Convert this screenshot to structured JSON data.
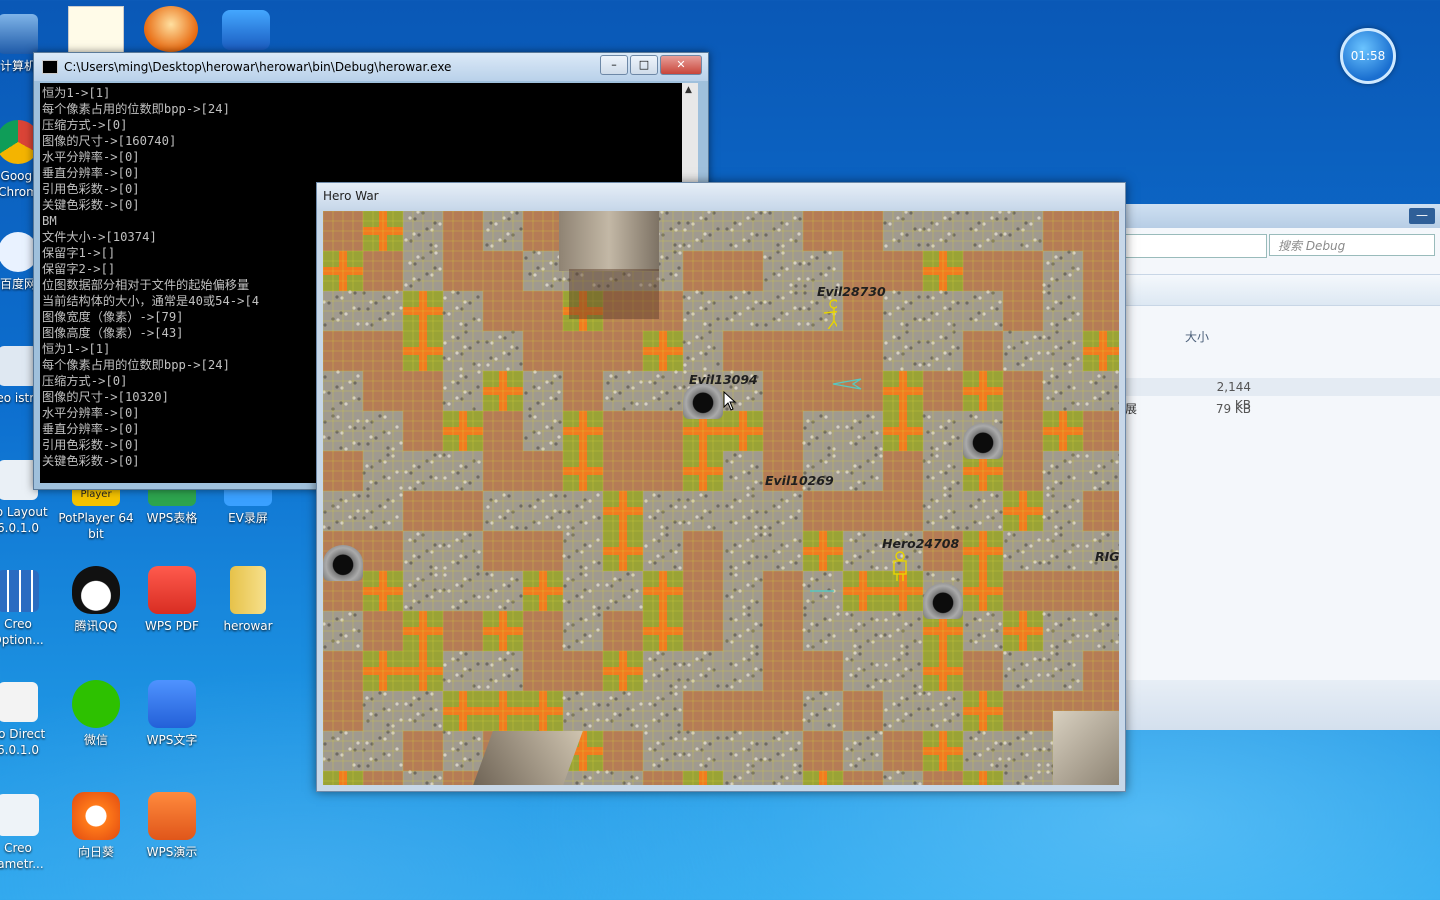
{
  "desktop": {
    "icons_col1": [
      {
        "label": "计算机",
        "icon": "computer-icon"
      },
      {
        "label": "Googl Chrom",
        "icon": "chrome-icon"
      },
      {
        "label": "百度网",
        "icon": "baidu-netdisk-icon"
      },
      {
        "label": "Creo istribu",
        "icon": "creo-icon"
      },
      {
        "label": "eo Layout 6.0.1.0",
        "icon": "creo-layout-icon"
      },
      {
        "label": "Creo Option...",
        "icon": "creo-options-icon"
      },
      {
        "label": "eo Direct 6.0.1.0",
        "icon": "creo-direct-icon"
      },
      {
        "label": "Creo rametr...",
        "icon": "creo-parametric-icon"
      }
    ],
    "icons_grid": [
      {
        "label": "PotPlayer 64 bit",
        "icon": "potplayer-icon"
      },
      {
        "label": "WPS表格",
        "icon": "wps-sheet-icon"
      },
      {
        "label": "EV录屏",
        "icon": "ev-recorder-icon"
      },
      {
        "label": "腾讯QQ",
        "icon": "qq-icon"
      },
      {
        "label": "WPS PDF",
        "icon": "wps-pdf-icon"
      },
      {
        "label": "herowar",
        "icon": "folder-icon"
      },
      {
        "label": "微信",
        "icon": "wechat-icon"
      },
      {
        "label": "WPS文字",
        "icon": "wps-writer-icon"
      },
      {
        "label": "向日葵",
        "icon": "sunflower-icon"
      },
      {
        "label": "WPS演示",
        "icon": "wps-present-icon"
      }
    ],
    "potplayer_badge": "Player",
    "clock": "01:58"
  },
  "console": {
    "title": "C:\\Users\\ming\\Desktop\\herowar\\herowar\\bin\\Debug\\herowar.exe",
    "lines": "恒为1->[1]\n每个像素占用的位数即bpp->[24]\n压缩方式->[0]\n图像的尺寸->[160740]\n水平分辨率->[0]\n垂直分辨率->[0]\n引用色彩数->[0]\n关键色彩数->[0]\nBM\n文件大小->[10374]\n保留字1->[]\n保留字2->[]\n位图数据部分相对于文件的起始偏移量\n当前结构体的大小，通常是40或54->[4\n图像宽度（像素）->[79]\n图像高度（像素）->[43]\n恒为1->[1]\n每个像素占用的位数即bpp->[24]\n压缩方式->[0]\n图像的尺寸->[10320]\n水平分辨率->[0]\n垂直分辨率->[0]\n引用色彩数->[0]\n关键色彩数->[0]"
  },
  "explorer": {
    "search_placeholder": "搜索 Debug",
    "col_size": "大小",
    "rows": [
      {
        "name": "",
        "size": "2,144 KB"
      },
      {
        "name": "展",
        "size": "79 KB"
      }
    ]
  },
  "game": {
    "title": "Hero War",
    "labels": [
      {
        "text": "Evil28730"
      },
      {
        "text": "Evil13094"
      },
      {
        "text": "Evil10269"
      },
      {
        "text": "Hero24708"
      },
      {
        "text": "RIG"
      }
    ],
    "colors": {
      "dirt": "#b57c56",
      "grid": "#d9d23a",
      "grass": "#f27b1f",
      "stone": "#a09a8f"
    }
  }
}
